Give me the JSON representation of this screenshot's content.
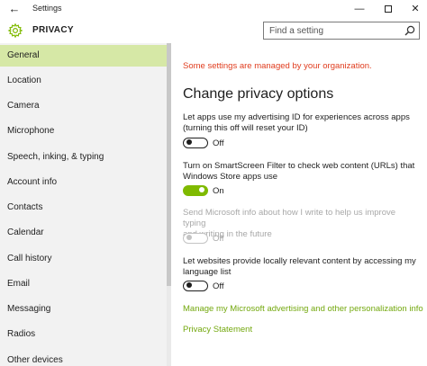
{
  "window": {
    "title": "Settings",
    "back_glyph": "←",
    "minimize_glyph": "—",
    "close_glyph": "✕"
  },
  "header": {
    "icon": "gear-icon",
    "title": "PRIVACY",
    "search_placeholder": "Find a setting",
    "search_value": ""
  },
  "sidebar": {
    "items": [
      {
        "label": "General",
        "active": true
      },
      {
        "label": "Location"
      },
      {
        "label": "Camera"
      },
      {
        "label": "Microphone"
      },
      {
        "label": "Speech, inking, & typing"
      },
      {
        "label": "Account info"
      },
      {
        "label": "Contacts"
      },
      {
        "label": "Calendar"
      },
      {
        "label": "Call history"
      },
      {
        "label": "Email"
      },
      {
        "label": "Messaging"
      },
      {
        "label": "Radios"
      },
      {
        "label": "Other devices"
      }
    ]
  },
  "main": {
    "notice": "Some settings are managed by your organization.",
    "title": "Change privacy options",
    "settings": [
      {
        "line1": "Let apps use my advertising ID for experiences across apps",
        "line2": "(turning this off will reset your ID)",
        "state": "Off",
        "enabled": true
      },
      {
        "line1": "Turn on SmartScreen Filter to check web content (URLs) that",
        "line2": "Windows Store apps use",
        "state": "On",
        "enabled": true
      },
      {
        "line1": "Send Microsoft info about how I write to help us improve typing",
        "line2": "and writing in the future",
        "state": "Off",
        "enabled": false
      },
      {
        "line1": "Let websites provide locally relevant content by accessing my",
        "line2": "language list",
        "state": "Off",
        "enabled": true
      }
    ],
    "links": {
      "advertising": "Manage my Microsoft advertising and other personalization info",
      "privacy": "Privacy Statement"
    }
  },
  "colors": {
    "accent": "#7fba00",
    "selected_bg": "#d6e8a6",
    "notice": "#e03c1e",
    "link": "#73a80e"
  }
}
